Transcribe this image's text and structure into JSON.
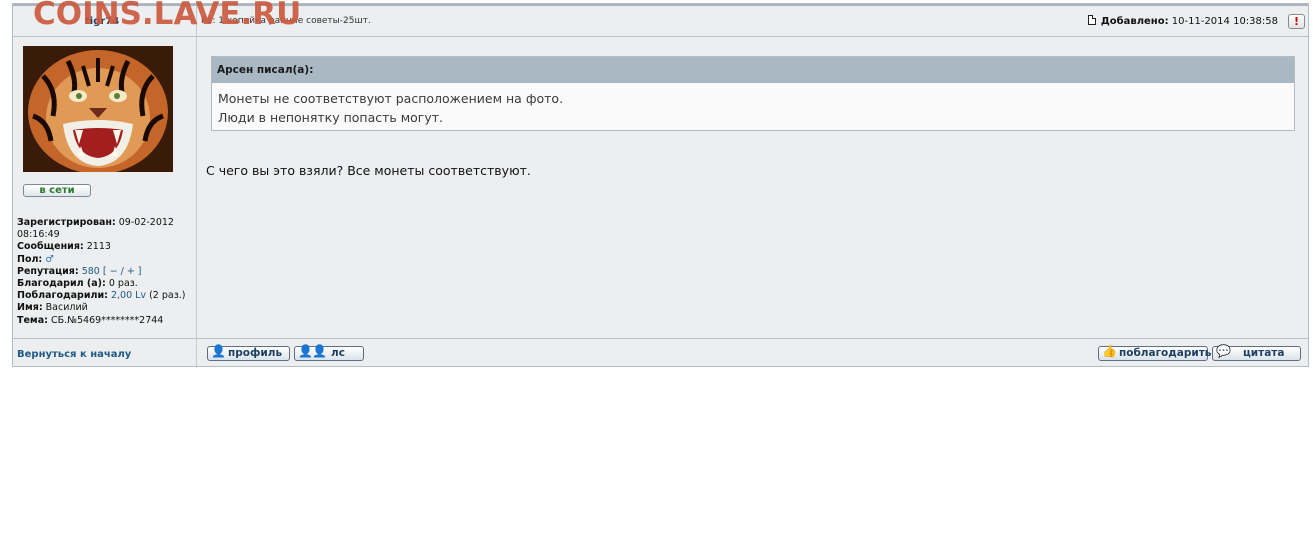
{
  "watermark": "COINS.LAVE.RU",
  "post": {
    "author": "tigr74",
    "subject": "Re: 1 копейка ранние советы-25шт.",
    "added_label": "Добавлено:",
    "added_value": "10-11-2014 10:38:58",
    "report_label": "!"
  },
  "user": {
    "online_label": "в сети",
    "registered_label": "Зарегистрирован:",
    "registered_value": "09-02-2012 08:16:49",
    "messages_label": "Сообщения:",
    "messages_value": "2113",
    "gender_label": "Пол:",
    "gender_icon": "male-symbol-icon",
    "reputation_label": "Репутация:",
    "reputation_value": "580",
    "reputation_controls": "[ − / + ]",
    "thanked_label": "Благодарил (а):",
    "thanked_value": "0 раз.",
    "thanked_by_label": "Поблагодарили:",
    "thanked_by_value": "2,00 Lv",
    "thanked_by_suffix": "(2 раз.)",
    "name_label": "Имя:",
    "name_value": "Василий",
    "topic_label": "Тема:",
    "topic_value": "СБ.№5469********2744"
  },
  "quote": {
    "header": "Арсен писал(а):",
    "lines": [
      "Монеты не соответствуют расположением на фото.",
      "Люди в непонятку попасть могут."
    ]
  },
  "message": "С чего вы это взяли? Все монеты соответствуют.",
  "footer": {
    "back_to_top": "Вернуться к началу",
    "profile_label": "профиль",
    "pm_label": "лс",
    "thanks_label": "поблагодарить",
    "quote_label": "цитата"
  },
  "colors": {
    "watermark": "#cc5a3f",
    "link": "#1f5a86",
    "quote_header_bg": "#a9b8c3",
    "post_bg": "#eceeef"
  }
}
